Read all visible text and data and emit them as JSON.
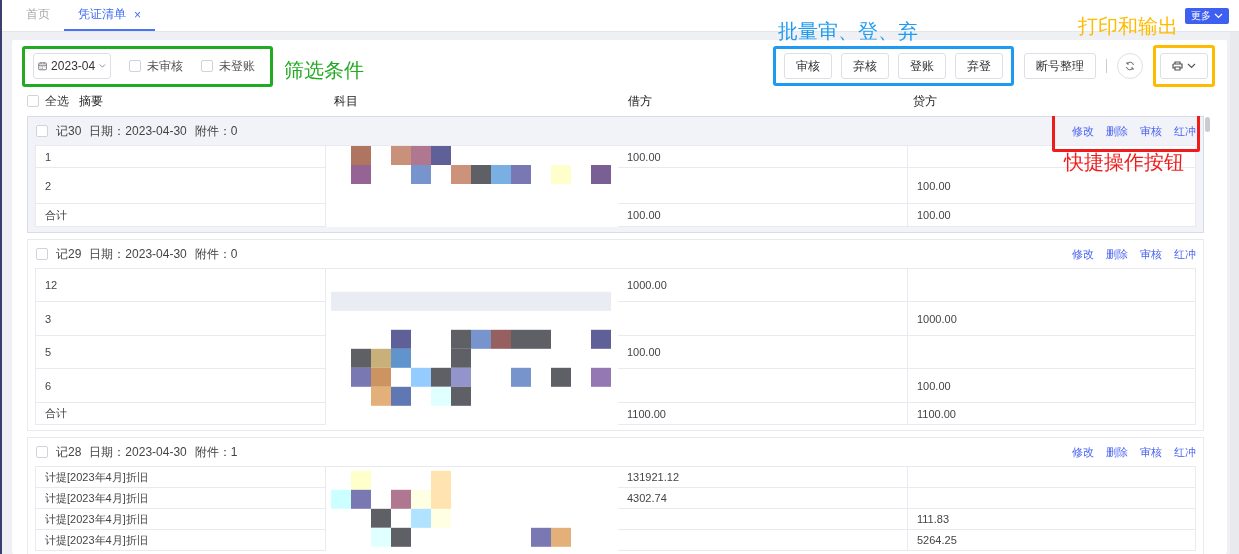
{
  "tabs": [
    {
      "label": "首页",
      "selected": false
    },
    {
      "label": "凭证清单",
      "selected": true,
      "close": "×"
    }
  ],
  "more_button": "更多",
  "toolbar": {
    "filters": {
      "date": "2023-04",
      "checkboxes": [
        {
          "label": "未审核",
          "checked": false
        },
        {
          "label": "未登账",
          "checked": false
        }
      ],
      "annotation": {
        "label": "筛选条件",
        "color": "#22aa22"
      }
    },
    "batch": {
      "buttons": [
        "审核",
        "弃核",
        "登账",
        "弃登"
      ],
      "annotation": {
        "label": "批量审、登、弃",
        "color": "#1e9bf0"
      }
    },
    "renumber_button": "断号整理",
    "print": {
      "annotation": {
        "label": "打印和输出",
        "color": "#ffbb00"
      }
    }
  },
  "columns": {
    "select_all": {
      "label": "全选",
      "checked": false
    },
    "headers": [
      "摘要",
      "科目",
      "借方",
      "贷方"
    ]
  },
  "vouchers": [
    {
      "number": "记30",
      "date": "日期：2023-04-30",
      "attachments": "附件：0",
      "checked": false,
      "hovered": true,
      "actions": [
        "修改",
        "删除",
        "审核",
        "红冲"
      ],
      "actions_annotation": {
        "label": "快捷操作按钮",
        "color": "#f01c1c"
      },
      "rows": [
        {
          "summary": "1",
          "debit": "100.00"
        },
        {
          "summary": "2",
          "credit": "100.00"
        },
        {
          "summary": "合计",
          "debit": "100.00",
          "credit": "100.00"
        }
      ]
    },
    {
      "number": "记29",
      "date": "日期：2023-04-30",
      "attachments": "附件：0",
      "checked": false,
      "hovered": false,
      "actions": [
        "修改",
        "删除",
        "审核",
        "红冲"
      ],
      "rows": [
        {
          "summary": "12",
          "debit": "1000.00"
        },
        {
          "summary": "3",
          "credit": "1000.00"
        },
        {
          "summary": "5",
          "debit": "100.00"
        },
        {
          "summary": "6",
          "credit": "100.00"
        },
        {
          "summary": "合计",
          "debit": "1100.00",
          "credit": "1100.00"
        }
      ]
    },
    {
      "number": "记28",
      "date": "日期：2023-04-30",
      "attachments": "附件：1",
      "checked": false,
      "hovered": false,
      "actions": [
        "修改",
        "删除",
        "审核",
        "红冲"
      ],
      "rows": [
        {
          "summary": "计提[2023年4月]折旧",
          "debit": "131921.12"
        },
        {
          "summary": "计提[2023年4月]折旧",
          "debit": "4302.74"
        },
        {
          "summary": "计提[2023年4月]折旧",
          "credit": "111.83"
        },
        {
          "summary": "计提[2023年4月]折旧",
          "credit": "5264.25"
        }
      ]
    }
  ]
}
